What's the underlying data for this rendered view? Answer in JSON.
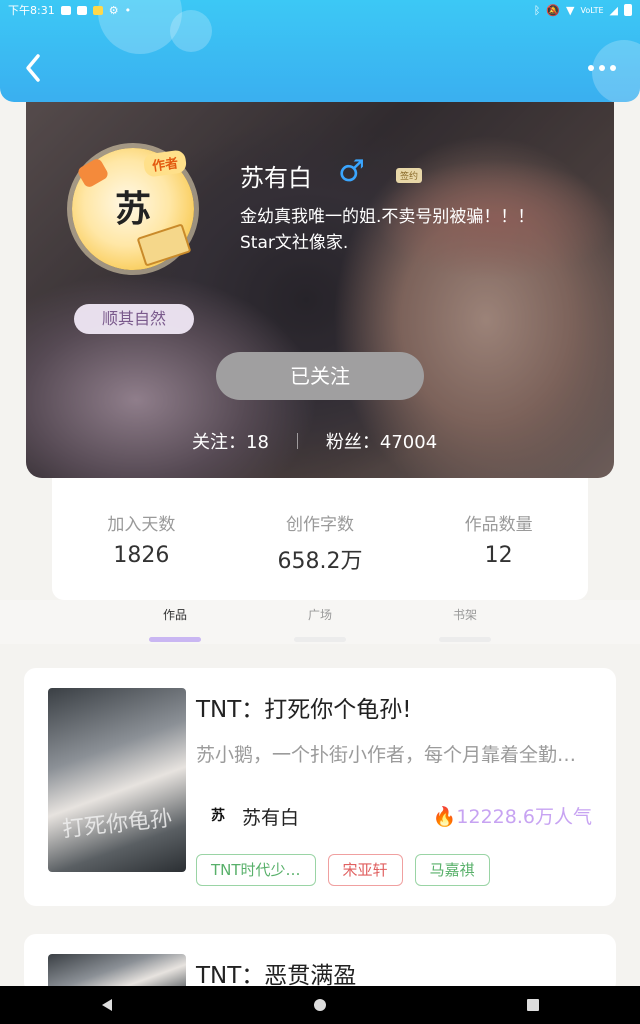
{
  "status_bar": {
    "time": "下午8:31",
    "network": "VoLTE"
  },
  "header": {
    "back_icon": "back-arrow-icon",
    "more_icon": "more-dots-icon"
  },
  "profile": {
    "avatar_char": "苏",
    "author_tag": "作者",
    "motto": "顺其自然",
    "name": "苏有白",
    "gender_symbol": "♂",
    "signed_badge": "签约",
    "bio_line1": "金幼真我唯一的姐.不卖号别被骗！！！",
    "bio_line2": "Star文社像家.",
    "follow_button": "已关注",
    "following": "关注：18",
    "followers": "粉丝：47004"
  },
  "stats": [
    {
      "label": "加入天数",
      "value": "1826"
    },
    {
      "label": "创作字数",
      "value": "658.2万"
    },
    {
      "label": "作品数量",
      "value": "12"
    }
  ],
  "tabs": [
    {
      "label": "作品",
      "active": true
    },
    {
      "label": "广场",
      "active": false
    },
    {
      "label": "书架",
      "active": false
    }
  ],
  "works": [
    {
      "title": "TNT：打死你个龟孙!",
      "desc": "苏小鹅，一个扑街小作者，每个月靠着全勤…",
      "author": "苏有白",
      "author_avatar_char": "苏",
      "popularity": "12228.6万人气",
      "cover_text": "打死你龟孙",
      "tags": [
        {
          "label": "TNT时代少…",
          "color": "green"
        },
        {
          "label": "宋亚轩",
          "color": "red"
        },
        {
          "label": "马嘉祺",
          "color": "green"
        }
      ]
    },
    {
      "title": "TNT：恶贯满盈"
    }
  ],
  "colors": {
    "header": "#3ab8f2",
    "accent": "#c9b6f2",
    "popularity": "#c7a3f2"
  }
}
